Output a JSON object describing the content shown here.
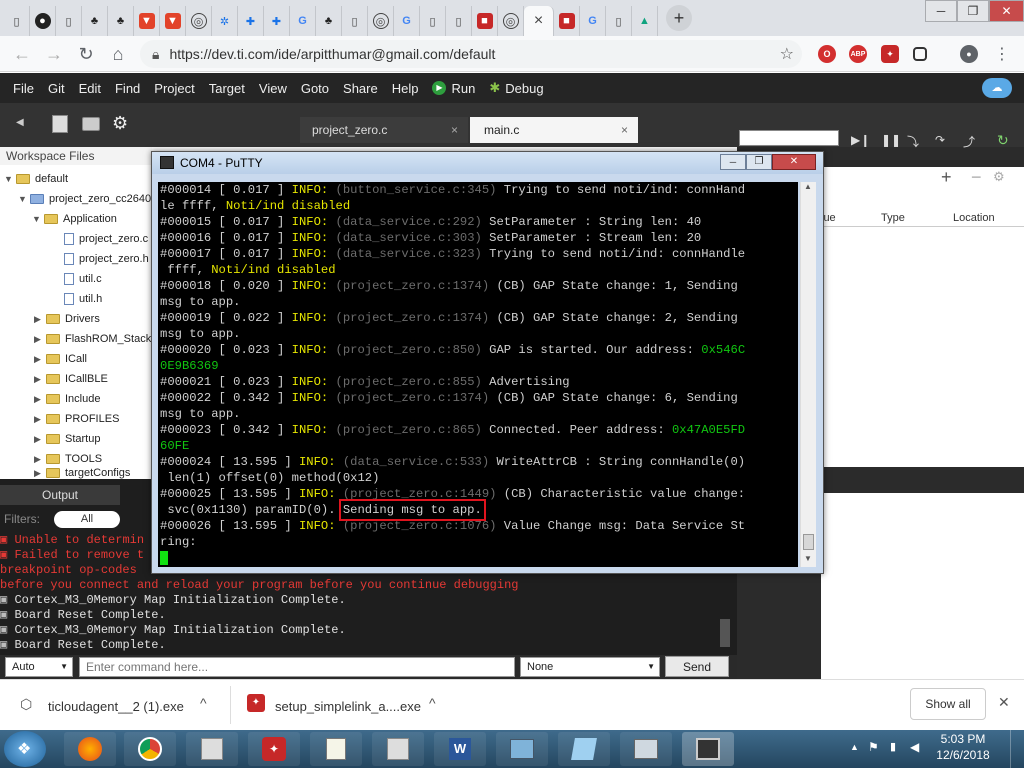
{
  "browser": {
    "tabs_active_label": "×",
    "new_tab": "+",
    "url": "https://dev.ti.com/ide/arpitthumar@gmail.com/default",
    "win_min": "─",
    "win_max": "❐",
    "win_close": "✕",
    "ext_abp": "ABP"
  },
  "ide": {
    "menu": [
      "File",
      "Git",
      "Edit",
      "Find",
      "Project",
      "Target",
      "View",
      "Goto",
      "Share",
      "Help"
    ],
    "run_label": "Run",
    "debug_label": "Debug",
    "editor_tabs": [
      {
        "label": "project_zero.c"
      },
      {
        "label": "main.c"
      }
    ],
    "tab_close": "×",
    "workspace_title": "Workspace Files",
    "tree": [
      {
        "label": "default"
      },
      {
        "label": "project_zero_cc2640"
      },
      {
        "label": "Application"
      },
      {
        "label": "project_zero.c"
      },
      {
        "label": "project_zero.h"
      },
      {
        "label": "util.c"
      },
      {
        "label": "util.h"
      },
      {
        "label": "Drivers"
      },
      {
        "label": "FlashROM_StackLi"
      },
      {
        "label": "ICall"
      },
      {
        "label": "ICallBLE"
      },
      {
        "label": "Include"
      },
      {
        "label": "PROFILES"
      },
      {
        "label": "Startup"
      },
      {
        "label": "TOOLS"
      },
      {
        "label": "targetConfigs"
      }
    ],
    "output_tab": "Output",
    "filters_label": "Filters:",
    "filter_all": "All",
    "output_lines": [
      {
        "text": "Unable to determin",
        "type": "error"
      },
      {
        "text": "Failed to remove t",
        "type": "error"
      },
      {
        "text": "breakpoint op-codes",
        "type": "error"
      },
      {
        "text": "before you connect and reload your program before you continue debugging",
        "type": "error"
      },
      {
        "text": "Cortex_M3_0Memory Map Initialization Complete.",
        "type": "info"
      },
      {
        "text": "Board Reset Complete.",
        "type": "info"
      },
      {
        "text": "Cortex_M3_0Memory Map Initialization Complete.",
        "type": "info"
      },
      {
        "text": "Board Reset Complete.",
        "type": "info"
      }
    ],
    "cmd_mode": "Auto",
    "cmd_placeholder": "Enter command here...",
    "cmd_target": "None",
    "send_label": "Send",
    "watch_columns": [
      "lue",
      "Type",
      "Location"
    ]
  },
  "putty": {
    "title": "COM4 - PuTTY",
    "lines": [
      [
        {
          "t": "#000014 [ 0.017 ] ",
          "c": "w"
        },
        {
          "t": "INFO: ",
          "c": "y"
        },
        {
          "t": "(button_service.c:345) ",
          "c": "g"
        },
        {
          "t": "Trying to send noti/ind: connHand",
          "c": "w"
        }
      ],
      [
        {
          "t": "le ffff, ",
          "c": "w"
        },
        {
          "t": "Noti/ind disabled",
          "c": "y"
        }
      ],
      [
        {
          "t": "#000015 [ 0.017 ] ",
          "c": "w"
        },
        {
          "t": "INFO: ",
          "c": "y"
        },
        {
          "t": "(data_service.c:292) ",
          "c": "g"
        },
        {
          "t": "SetParameter : String len: 40",
          "c": "w"
        }
      ],
      [
        {
          "t": "#000016 [ 0.017 ] ",
          "c": "w"
        },
        {
          "t": "INFO: ",
          "c": "y"
        },
        {
          "t": "(data_service.c:303) ",
          "c": "g"
        },
        {
          "t": "SetParameter : Stream len: 20",
          "c": "w"
        }
      ],
      [
        {
          "t": "#000017 [ 0.017 ] ",
          "c": "w"
        },
        {
          "t": "INFO: ",
          "c": "y"
        },
        {
          "t": "(data_service.c:323) ",
          "c": "g"
        },
        {
          "t": "Trying to send noti/ind: connHandle",
          "c": "w"
        }
      ],
      [
        {
          "t": " ffff, ",
          "c": "w"
        },
        {
          "t": "Noti/ind disabled",
          "c": "y"
        }
      ],
      [
        {
          "t": "#000018 [ 0.020 ] ",
          "c": "w"
        },
        {
          "t": "INFO: ",
          "c": "y"
        },
        {
          "t": "(project_zero.c:1374) ",
          "c": "g"
        },
        {
          "t": "(CB) GAP State change: 1, Sending",
          "c": "w"
        }
      ],
      [
        {
          "t": "msg to app.",
          "c": "w"
        }
      ],
      [
        {
          "t": "#000019 [ 0.022 ] ",
          "c": "w"
        },
        {
          "t": "INFO: ",
          "c": "y"
        },
        {
          "t": "(project_zero.c:1374) ",
          "c": "g"
        },
        {
          "t": "(CB) GAP State change: 2, Sending",
          "c": "w"
        }
      ],
      [
        {
          "t": "msg to app.",
          "c": "w"
        }
      ],
      [
        {
          "t": "#000020 [ 0.023 ] ",
          "c": "w"
        },
        {
          "t": "INFO: ",
          "c": "y"
        },
        {
          "t": "(project_zero.c:850) ",
          "c": "g"
        },
        {
          "t": "GAP is started. Our address: ",
          "c": "w"
        },
        {
          "t": "0x546C",
          "c": "gr"
        }
      ],
      [
        {
          "t": "0E9B6369",
          "c": "gr"
        }
      ],
      [
        {
          "t": "#000021 [ 0.023 ] ",
          "c": "w"
        },
        {
          "t": "INFO: ",
          "c": "y"
        },
        {
          "t": "(project_zero.c:855) ",
          "c": "g"
        },
        {
          "t": "Advertising",
          "c": "w"
        }
      ],
      [
        {
          "t": "#000022 [ 0.342 ] ",
          "c": "w"
        },
        {
          "t": "INFO: ",
          "c": "y"
        },
        {
          "t": "(project_zero.c:1374) ",
          "c": "g"
        },
        {
          "t": "(CB) GAP State change: 6, Sending",
          "c": "w"
        }
      ],
      [
        {
          "t": "msg to app.",
          "c": "w"
        }
      ],
      [
        {
          "t": "#000023 [ 0.342 ] ",
          "c": "w"
        },
        {
          "t": "INFO: ",
          "c": "y"
        },
        {
          "t": "(project_zero.c:865) ",
          "c": "g"
        },
        {
          "t": "Connected. Peer address: ",
          "c": "w"
        },
        {
          "t": "0x47A0E5FD",
          "c": "gr"
        }
      ],
      [
        {
          "t": "60FE",
          "c": "gr"
        }
      ],
      [
        {
          "t": "#000024 [ 13.595 ] ",
          "c": "w"
        },
        {
          "t": "INFO: ",
          "c": "y"
        },
        {
          "t": "(data_service.c:533) ",
          "c": "g"
        },
        {
          "t": "WriteAttrCB : String connHandle(0)",
          "c": "w"
        }
      ],
      [
        {
          "t": " len(1) offset(0) method(0x12)",
          "c": "w"
        }
      ],
      [
        {
          "t": "#000025 [ 13.595 ] ",
          "c": "w"
        },
        {
          "t": "INFO: ",
          "c": "y"
        },
        {
          "t": "(project_zero.c:1449) ",
          "c": "g"
        },
        {
          "t": "(CB) Characteristic value change:",
          "c": "w"
        }
      ],
      [
        {
          "t": " svc(0x1130) paramID(0). ",
          "c": "w"
        },
        {
          "t": "Sending msg to app.",
          "c": "w",
          "hl": true
        }
      ],
      [
        {
          "t": "#000026 [ 13.595 ] ",
          "c": "w"
        },
        {
          "t": "INFO: ",
          "c": "y"
        },
        {
          "t": "(project_zero.c:1076) ",
          "c": "g"
        },
        {
          "t": "Value Change msg: Data Service St",
          "c": "w"
        }
      ],
      [
        {
          "t": "ring:",
          "c": "w"
        }
      ]
    ]
  },
  "downloads": {
    "items": [
      {
        "name": "ticloudagent__2 (1).exe"
      },
      {
        "name": "setup_simplelink_a....exe"
      }
    ],
    "show_all": "Show all",
    "close": "✕"
  },
  "taskbar": {
    "time": "5:03 PM",
    "date": "12/6/2018"
  },
  "colors": {
    "terminal_bg": "#000000",
    "info_yellow": "#e6e600",
    "address_green": "#11c711",
    "highlight_box": "#e0141e",
    "ide_dark": "#252525"
  }
}
